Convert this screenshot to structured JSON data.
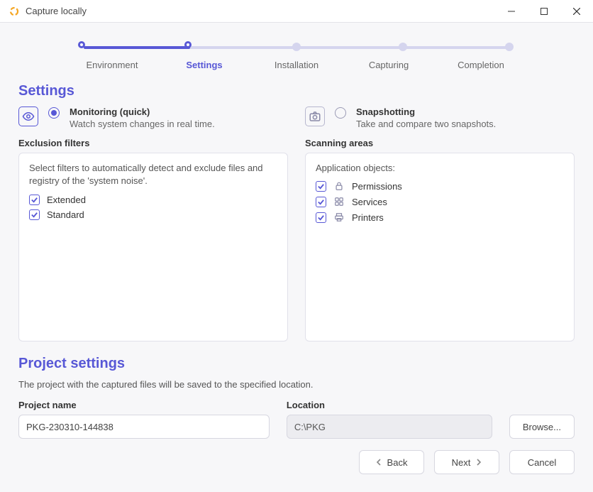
{
  "titlebar": {
    "title": "Capture locally"
  },
  "stepper": {
    "steps": [
      {
        "label": "Environment",
        "state": "done"
      },
      {
        "label": "Settings",
        "state": "current"
      },
      {
        "label": "Installation",
        "state": "future"
      },
      {
        "label": "Capturing",
        "state": "future"
      },
      {
        "label": "Completion",
        "state": "future"
      }
    ]
  },
  "page": {
    "heading": "Settings",
    "modes": {
      "monitoring": {
        "title": "Monitoring (quick)",
        "desc": "Watch system changes in real time.",
        "selected": true
      },
      "snapshotting": {
        "title": "Snapshotting",
        "desc": "Take and compare two snapshots.",
        "selected": false
      }
    },
    "exclusion": {
      "heading": "Exclusion filters",
      "intro": "Select filters to automatically detect and exclude files and registry of the 'system noise'.",
      "filters": [
        {
          "label": "Extended",
          "checked": true
        },
        {
          "label": "Standard",
          "checked": true
        }
      ]
    },
    "scanning": {
      "heading": "Scanning areas",
      "intro": "Application objects:",
      "items": [
        {
          "label": "Permissions",
          "icon": "lock-icon",
          "checked": true
        },
        {
          "label": "Services",
          "icon": "services-icon",
          "checked": true
        },
        {
          "label": "Printers",
          "icon": "printer-icon",
          "checked": true
        }
      ]
    }
  },
  "project": {
    "heading": "Project settings",
    "desc": "The project with the captured files will be saved to the specified location.",
    "name_label": "Project name",
    "name_value": "PKG-230310-144838",
    "location_label": "Location",
    "location_value": "C:\\PKG",
    "browse_label": "Browse..."
  },
  "footer": {
    "back": "Back",
    "next": "Next",
    "cancel": "Cancel"
  }
}
